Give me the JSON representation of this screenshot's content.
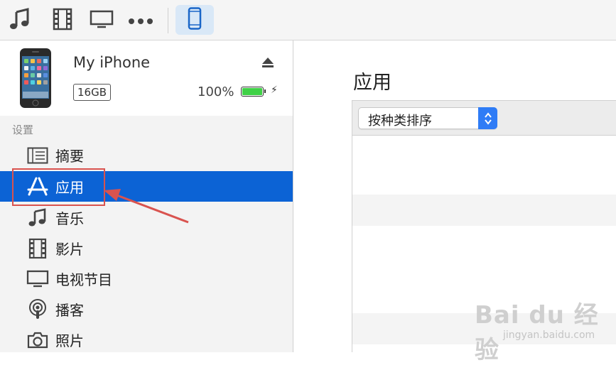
{
  "toolbar": {
    "items": [
      {
        "icon": "music-note-icon"
      },
      {
        "icon": "film-icon"
      },
      {
        "icon": "tv-icon"
      },
      {
        "icon": "more-icon"
      },
      {
        "icon": "iphone-icon",
        "selected": true
      }
    ]
  },
  "device": {
    "name": "My iPhone",
    "capacity": "16GB",
    "battery_text": "100%",
    "battery_level": 1.0,
    "charging": true
  },
  "sidebar": {
    "section_title": "设置",
    "items": [
      {
        "label": "摘要",
        "icon": "summary-list-icon",
        "active": false
      },
      {
        "label": "应用",
        "icon": "app-store-icon",
        "active": true
      },
      {
        "label": "音乐",
        "icon": "music-note-icon",
        "active": false
      },
      {
        "label": "影片",
        "icon": "film-icon",
        "active": false
      },
      {
        "label": "电视节目",
        "icon": "tv-icon",
        "active": false
      },
      {
        "label": "播客",
        "icon": "podcast-icon",
        "active": false
      },
      {
        "label": "照片",
        "icon": "camera-icon",
        "active": false
      }
    ]
  },
  "main": {
    "title": "应用",
    "sort_select": {
      "value": "按种类排序"
    }
  },
  "annotation": {
    "color": "#d9534f"
  },
  "watermark": {
    "logo": "Bai du 经验",
    "sub": "jingyan.baidu.com"
  },
  "colors": {
    "accent": "#0c63d5",
    "battery": "#3fd146",
    "stepper": "#2f7cf6"
  }
}
